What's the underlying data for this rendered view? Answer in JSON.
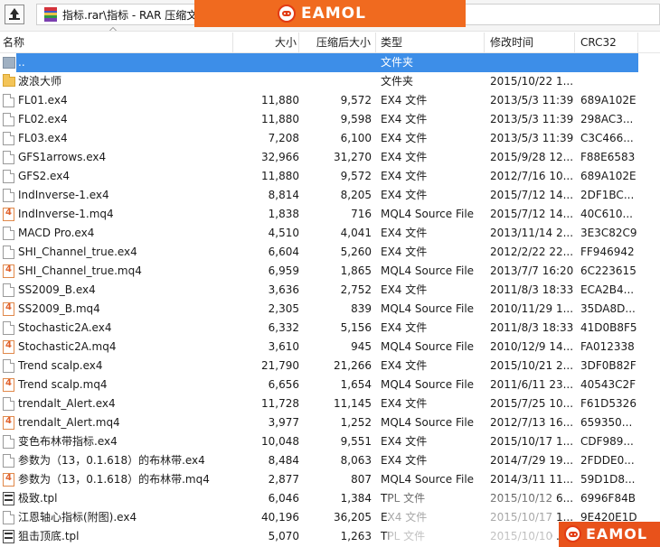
{
  "toolbar": {
    "up_icon": "up-arrow-icon",
    "address": "指标.rar\\指标 - RAR 压缩文",
    "archive_icon": "rar-archive-icon"
  },
  "banner": {
    "brand": "EAMOL",
    "logo_icon": "eamol-logo-icon",
    "color": "#f06a1f"
  },
  "watermark": {
    "brand": "EAMOL",
    "color": "#e8521b"
  },
  "columns": [
    {
      "key": "name",
      "label": "名称"
    },
    {
      "key": "size",
      "label": "大小"
    },
    {
      "key": "packed",
      "label": "压缩后大小"
    },
    {
      "key": "type",
      "label": "类型"
    },
    {
      "key": "modified",
      "label": "修改时间"
    },
    {
      "key": "crc",
      "label": "CRC32"
    }
  ],
  "selection_color": "#3d8ee8",
  "rows": [
    {
      "icon": "folder-up",
      "name": "..",
      "size": "",
      "packed": "",
      "type": "文件夹",
      "modified": "",
      "crc": "",
      "selected": true
    },
    {
      "icon": "folder",
      "name": "波浪大师",
      "size": "",
      "packed": "",
      "type": "文件夹",
      "modified": "2015/10/22 1...",
      "crc": ""
    },
    {
      "icon": "file",
      "name": "FL01.ex4",
      "size": "11,880",
      "packed": "9,572",
      "type": "EX4 文件",
      "modified": "2013/5/3 11:39",
      "crc": "689A102E"
    },
    {
      "icon": "file",
      "name": "FL02.ex4",
      "size": "11,880",
      "packed": "9,598",
      "type": "EX4 文件",
      "modified": "2013/5/3 11:39",
      "crc": "298AC3..."
    },
    {
      "icon": "file",
      "name": "FL03.ex4",
      "size": "7,208",
      "packed": "6,100",
      "type": "EX4 文件",
      "modified": "2013/5/3 11:39",
      "crc": "C3C466..."
    },
    {
      "icon": "file",
      "name": "GFS1arrows.ex4",
      "size": "32,966",
      "packed": "31,270",
      "type": "EX4 文件",
      "modified": "2015/9/28 12...",
      "crc": "F88E6583"
    },
    {
      "icon": "file",
      "name": "GFS2.ex4",
      "size": "11,880",
      "packed": "9,572",
      "type": "EX4 文件",
      "modified": "2012/7/16 10...",
      "crc": "689A102E"
    },
    {
      "icon": "file",
      "name": "IndInverse-1.ex4",
      "size": "8,814",
      "packed": "8,205",
      "type": "EX4 文件",
      "modified": "2015/7/12 14...",
      "crc": "2DF1BC..."
    },
    {
      "icon": "mq4",
      "name": "IndInverse-1.mq4",
      "size": "1,838",
      "packed": "716",
      "type": "MQL4 Source File",
      "modified": "2015/7/12 14...",
      "crc": "40C610..."
    },
    {
      "icon": "file",
      "name": "MACD Pro.ex4",
      "size": "4,510",
      "packed": "4,041",
      "type": "EX4 文件",
      "modified": "2013/11/14 2...",
      "crc": "3E3C82C9"
    },
    {
      "icon": "file",
      "name": "SHI_Channel_true.ex4",
      "size": "6,604",
      "packed": "5,260",
      "type": "EX4 文件",
      "modified": "2012/2/22 22...",
      "crc": "FF946942"
    },
    {
      "icon": "mq4",
      "name": "SHI_Channel_true.mq4",
      "size": "6,959",
      "packed": "1,865",
      "type": "MQL4 Source File",
      "modified": "2013/7/7 16:20",
      "crc": "6C223615"
    },
    {
      "icon": "file",
      "name": "SS2009_B.ex4",
      "size": "3,636",
      "packed": "2,752",
      "type": "EX4 文件",
      "modified": "2011/8/3 18:33",
      "crc": "ECA2B4..."
    },
    {
      "icon": "mq4",
      "name": "SS2009_B.mq4",
      "size": "2,305",
      "packed": "839",
      "type": "MQL4 Source File",
      "modified": "2010/11/29 1...",
      "crc": "35DA8D..."
    },
    {
      "icon": "file",
      "name": "Stochastic2A.ex4",
      "size": "6,332",
      "packed": "5,156",
      "type": "EX4 文件",
      "modified": "2011/8/3 18:33",
      "crc": "41D0B8F5"
    },
    {
      "icon": "mq4",
      "name": "Stochastic2A.mq4",
      "size": "3,610",
      "packed": "945",
      "type": "MQL4 Source File",
      "modified": "2010/12/9 14...",
      "crc": "FA012338"
    },
    {
      "icon": "file",
      "name": "Trend scalp.ex4",
      "size": "21,790",
      "packed": "21,266",
      "type": "EX4 文件",
      "modified": "2015/10/21 2...",
      "crc": "3DF0B82F"
    },
    {
      "icon": "mq4",
      "name": "Trend scalp.mq4",
      "size": "6,656",
      "packed": "1,654",
      "type": "MQL4 Source File",
      "modified": "2011/6/11 23...",
      "crc": "40543C2F"
    },
    {
      "icon": "file",
      "name": "trendalt_Alert.ex4",
      "size": "11,728",
      "packed": "11,145",
      "type": "EX4 文件",
      "modified": "2015/7/25 10...",
      "crc": "F61D5326"
    },
    {
      "icon": "mq4",
      "name": "trendalt_Alert.mq4",
      "size": "3,977",
      "packed": "1,252",
      "type": "MQL4 Source File",
      "modified": "2012/7/13 16...",
      "crc": "659350..."
    },
    {
      "icon": "file",
      "name": "变色布林带指标.ex4",
      "size": "10,048",
      "packed": "9,551",
      "type": "EX4 文件",
      "modified": "2015/10/17 1...",
      "crc": "CDF989..."
    },
    {
      "icon": "file",
      "name": "参数为（13，0.1.618）的布林带.ex4",
      "size": "8,484",
      "packed": "8,063",
      "type": "EX4 文件",
      "modified": "2014/7/29 19...",
      "crc": "2FDDE0..."
    },
    {
      "icon": "mq4",
      "name": "参数为（13，0.1.618）的布林带.mq4",
      "size": "2,877",
      "packed": "807",
      "type": "MQL4 Source File",
      "modified": "2014/3/11 11...",
      "crc": "59D1D8..."
    },
    {
      "icon": "tpl",
      "name": "极致.tpl",
      "size": "6,046",
      "packed": "1,384",
      "type": "TPL 文件",
      "modified": "2015/10/12 6...",
      "crc": "6996F84B"
    },
    {
      "icon": "file",
      "name": "江恩轴心指标(附图).ex4",
      "size": "40,196",
      "packed": "36,205",
      "type": "EX4 文件",
      "modified": "2015/10/17 1...",
      "crc": "9E420E1D"
    },
    {
      "icon": "tpl",
      "name": "狙击顶底.tpl",
      "size": "5,070",
      "packed": "1,263",
      "type": "TPL 文件",
      "modified": "2015/10/10 ...",
      "crc": ""
    }
  ]
}
